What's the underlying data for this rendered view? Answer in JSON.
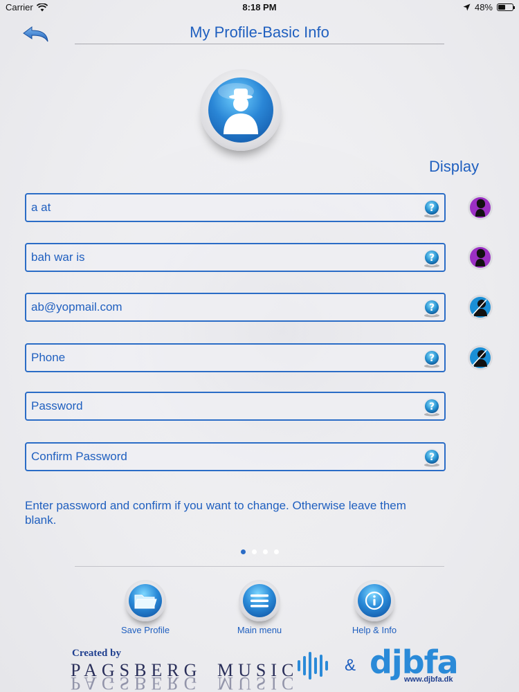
{
  "status_bar": {
    "carrier": "Carrier",
    "time": "8:18 PM",
    "battery": "48%",
    "battery_level": 0.48
  },
  "header": {
    "title": "My Profile-Basic Info",
    "back_icon": "back-arrow-icon"
  },
  "avatar": {
    "icon": "person-silhouette-icon"
  },
  "display_label": "Display",
  "fields": [
    {
      "value": "a at",
      "placeholder": "",
      "display_icon": "female-silhouette-icon"
    },
    {
      "value": "bah war is",
      "placeholder": "",
      "display_icon": "female-silhouette-icon"
    },
    {
      "value": "ab@yopmail.com",
      "placeholder": "",
      "display_icon": "male-silhouette-icon"
    },
    {
      "value": "",
      "placeholder": "Phone",
      "display_icon": "male-silhouette-icon"
    },
    {
      "value": "",
      "placeholder": "Password"
    },
    {
      "value": "",
      "placeholder": "Confirm Password"
    }
  ],
  "note": "Enter password and confirm if you want to change. Otherwise leave them blank.",
  "pager": {
    "count": 4,
    "active": 0
  },
  "nav": {
    "save_label": "Save Profile",
    "menu_label": "Main menu",
    "help_label": "Help & Info"
  },
  "footer": {
    "created_by": "Created by",
    "pagsberg": "PAGSBERG",
    "music": "MUSIC",
    "amp": "&",
    "djbfa": "djbfa",
    "url": "www.djbfa.dk"
  },
  "colors": {
    "accent": "#1f5fbf",
    "field_border": "#2a6cc6",
    "female_icon": "#9b2fc4",
    "male_icon": "#1a8fd6"
  }
}
